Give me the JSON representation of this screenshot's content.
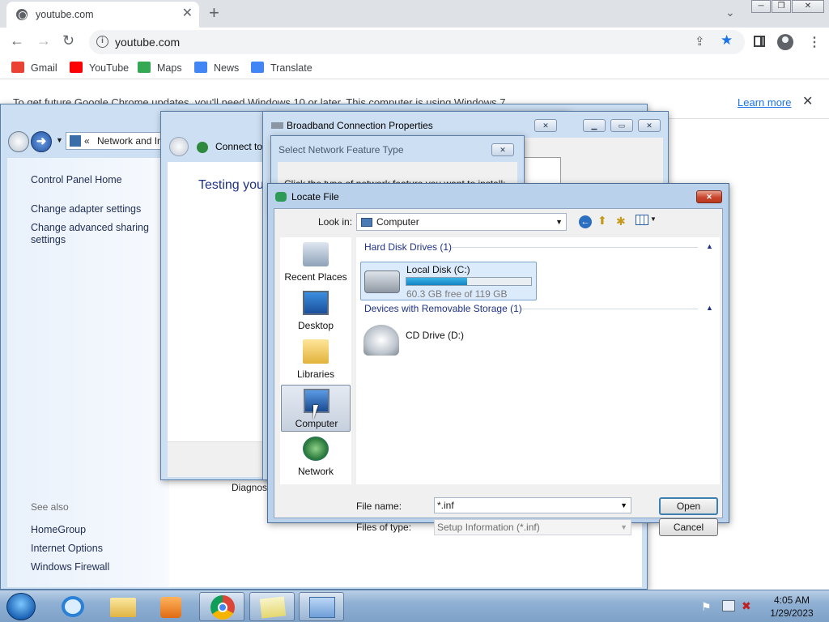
{
  "browser": {
    "tab_title": "youtube.com",
    "tab_close": "✕",
    "new_tab": "+",
    "url": "youtube.com",
    "bookmarks": [
      {
        "label": "Gmail",
        "color": "#ea4335"
      },
      {
        "label": "YouTube",
        "color": "#ff0000"
      },
      {
        "label": "Maps",
        "color": "#34a853"
      },
      {
        "label": "News",
        "color": "#4285f4"
      },
      {
        "label": "Translate",
        "color": "#4285f4"
      }
    ],
    "infobar_message": "To get future Google Chrome updates, you'll need Windows 10 or later. This computer is using Windows 7.",
    "learn_more": "Learn more"
  },
  "control_panel": {
    "breadcrumb": "Network and Internet",
    "links": [
      "Control Panel Home",
      "Change adapter settings",
      "Change advanced sharing settings"
    ],
    "see_also_label": "See also",
    "see_also": [
      "HomeGroup",
      "Internet Options",
      "Windows Firewall"
    ],
    "diagnose": "Diagnose"
  },
  "connect_window": {
    "title": "Connect to",
    "status": "Testing you"
  },
  "broadband_properties": {
    "title": "Broadband Connection Properties"
  },
  "network_feature": {
    "title": "Select Network Feature Type",
    "hint": "Click the type of network feature you want to install:"
  },
  "locate_file": {
    "title": "Locate File",
    "look_in_label": "Look in:",
    "look_in_value": "Computer",
    "places": [
      "Recent Places",
      "Desktop",
      "Libraries",
      "Computer",
      "Network"
    ],
    "selected_place": "Computer",
    "groups": [
      {
        "label": "Hard Disk Drives (1)"
      },
      {
        "label": "Devices with Removable Storage (1)"
      }
    ],
    "drives": [
      {
        "name": "Local Disk (C:)",
        "free": "60.3 GB free of 119 GB",
        "used_fraction": 0.49
      },
      {
        "name": "CD Drive (D:)"
      }
    ],
    "file_name_label": "File name:",
    "file_name_value": "*.inf",
    "files_of_type_label": "Files of type:",
    "files_of_type_value": "Setup Information (*.inf)",
    "open_button": "Open",
    "cancel_button": "Cancel"
  },
  "taskbar": {
    "time": "4:05 AM",
    "date": "1/29/2023"
  }
}
